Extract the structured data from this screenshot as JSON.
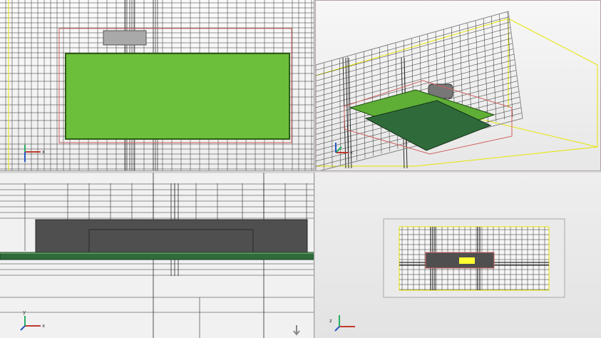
{
  "viewports": [
    {
      "id": "top",
      "axis": {
        "h": "x",
        "v": "y"
      }
    },
    {
      "id": "perspective",
      "axis": {
        "h": "x",
        "v": "y"
      }
    },
    {
      "id": "front",
      "axis": {
        "h": "x",
        "v": "y"
      }
    },
    {
      "id": "camera",
      "axis": {
        "h": "x",
        "v": "y"
      }
    }
  ],
  "colors": {
    "board_green": "#6cbf3a",
    "pcb_dark_green": "#2f6b3a",
    "component_gray": "#4f4f4f",
    "grid_line": "#2b2b2b",
    "selection_box": "#d06060",
    "bounding_yellow": "#e6e600",
    "axis_x": "#c0392b",
    "axis_y": "#27ae60",
    "axis_z": "#2456c4"
  },
  "icons": [
    "axis-gizmo-icon",
    "scroll-arrow-icon"
  ]
}
